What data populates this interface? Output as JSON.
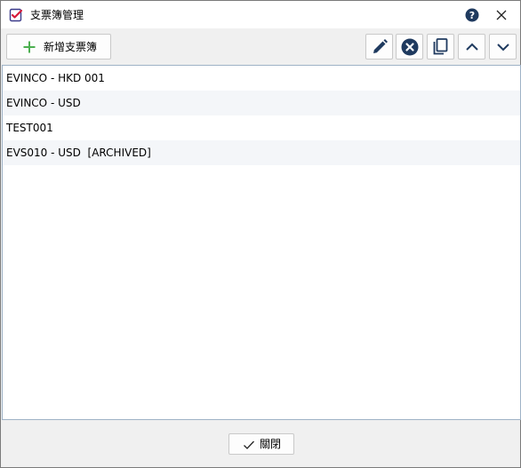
{
  "window": {
    "title": "支票簿管理",
    "app_icon": "checklist-icon",
    "help_icon": "help-icon",
    "close_icon": "close-icon"
  },
  "toolbar": {
    "add_label": "新增支票簿",
    "add_icon": "plus-icon",
    "buttons": [
      {
        "icon": "pencil-icon"
      },
      {
        "icon": "remove-circle-icon"
      },
      {
        "icon": "copy-icon"
      },
      {
        "icon": "chevron-up-icon"
      },
      {
        "icon": "chevron-down-icon"
      }
    ]
  },
  "list": {
    "items": [
      {
        "label": "EVINCO - HKD 001"
      },
      {
        "label": "EVINCO - USD"
      },
      {
        "label": "TEST001"
      },
      {
        "label": "EVS010 - USD  [ARCHIVED]"
      }
    ]
  },
  "footer": {
    "close_label": "關閉",
    "close_icon": "checkmark-icon"
  },
  "colors": {
    "accent_green": "#4caf50",
    "icon_dark": "#1f3a5f",
    "alt_row": "#f4f6f9"
  }
}
